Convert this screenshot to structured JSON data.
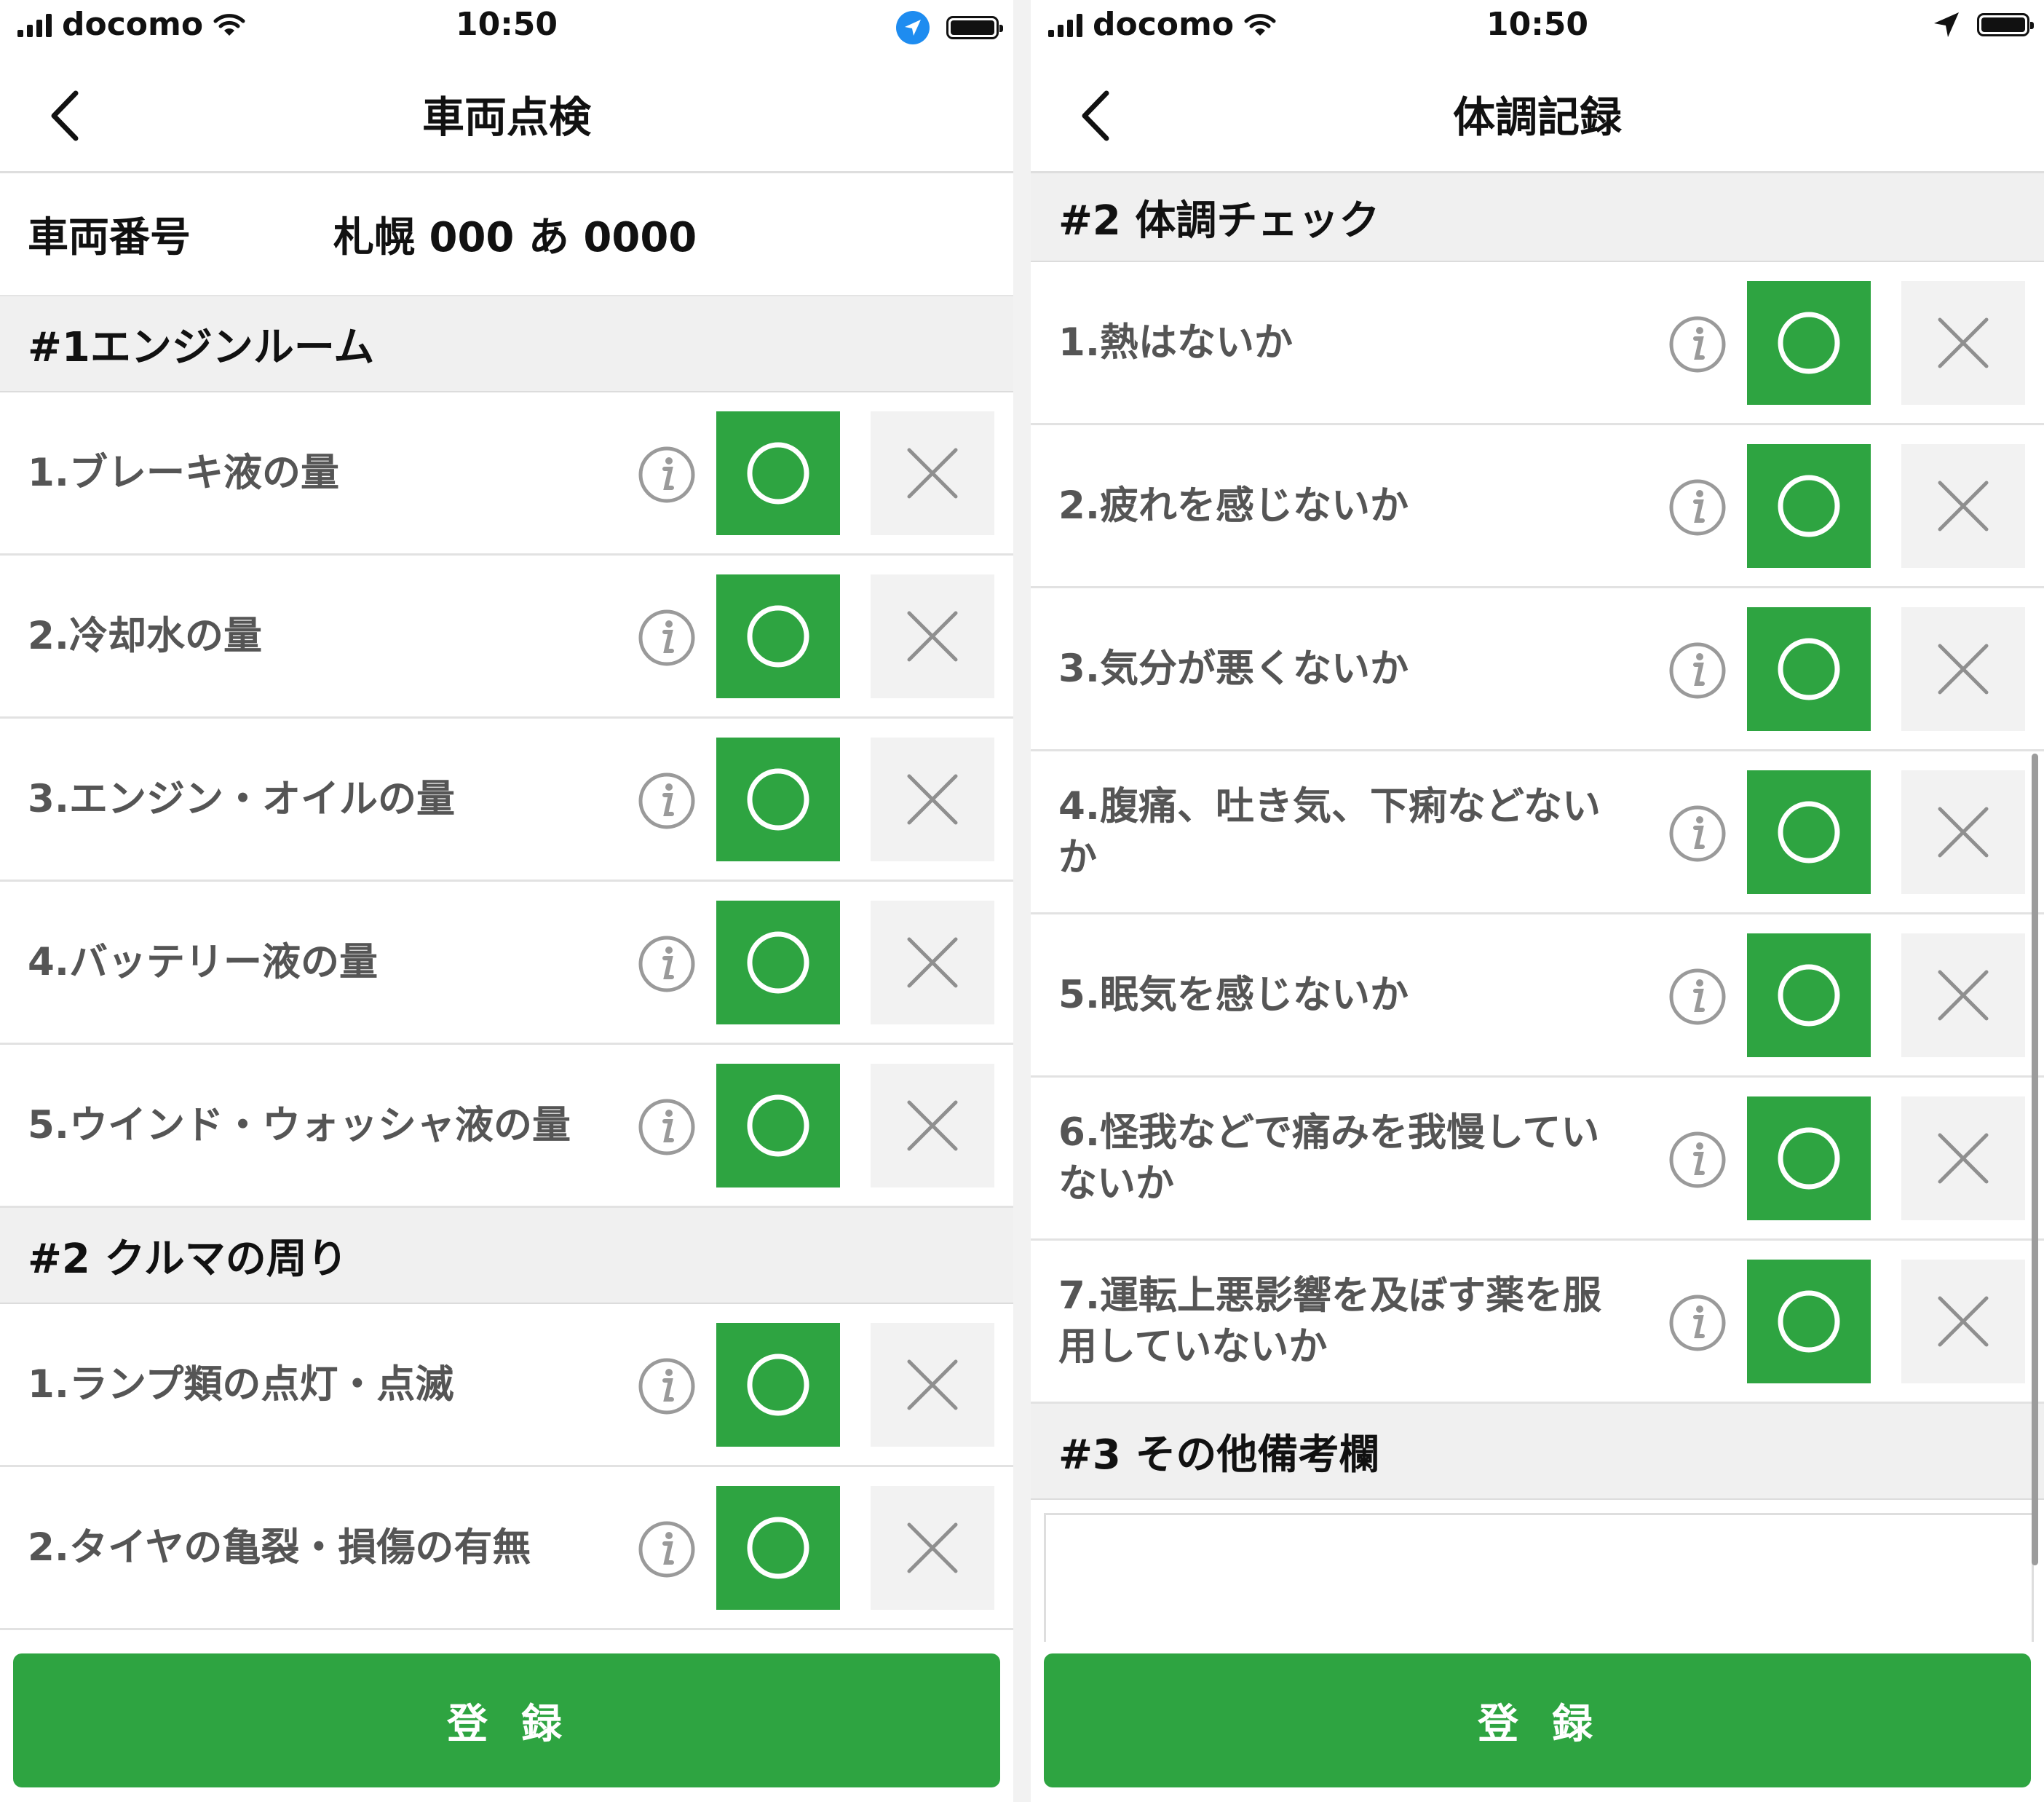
{
  "left_screen": {
    "status": {
      "carrier": "docomo",
      "time": "10:50"
    },
    "nav": {
      "title": "車両点検"
    },
    "vehicle": {
      "label": "車両番号",
      "value": "札幌 000 あ 0000"
    },
    "sections": [
      {
        "title": "#1エンジンルーム",
        "items": [
          "1.ブレーキ液の量",
          "2.冷却水の量",
          "3.エンジン・オイルの量",
          "4.バッテリー液の量",
          "5.ウインド・ウォッシャ液の量"
        ]
      },
      {
        "title": "#2 クルマの周り",
        "items": [
          "1.ランプ類の点灯・点滅",
          "2.タイヤの亀裂・損傷の有無"
        ]
      }
    ],
    "submit_label": "登録"
  },
  "right_screen": {
    "status": {
      "carrier": "docomo",
      "time": "10:50"
    },
    "nav": {
      "title": "体調記録"
    },
    "sections": [
      {
        "title": "#2 体調チェック",
        "items": [
          "1.熱はないか",
          "2.疲れを感じないか",
          "3.気分が悪くないか",
          "4.腹痛、吐き気、下痢などないか",
          "5.眠気を感じないか",
          "6.怪我などで痛みを我慢していないか",
          "7.運転上悪影響を及ぼす薬を服用していないか"
        ]
      },
      {
        "title": "#3 その他備考欄",
        "remarks_value": ""
      }
    ],
    "submit_label": "登録"
  },
  "colors": {
    "accent_green": "#2ea441",
    "location_blue": "#1e8cf0",
    "section_bg": "#f0f0f0",
    "ng_bg": "#f2f2f2"
  },
  "icons": {
    "check_ok": "circle-icon",
    "check_ng": "cross-icon",
    "info": "info-icon",
    "back": "chevron-left-icon"
  }
}
